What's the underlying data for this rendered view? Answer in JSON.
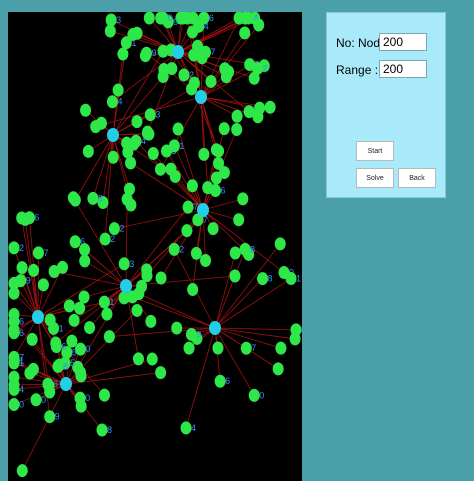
{
  "controls": {
    "nodes_label": "No: Nodes:",
    "nodes_value": "200",
    "range_label": "Range   :",
    "range_value": "200",
    "start_label": "Start",
    "solve_label": "Solve",
    "back_label": "Back"
  },
  "colors": {
    "canvas_bg": "#000000",
    "node": "#2ee84a",
    "hub": "#22cfe6",
    "edge": "#a01010",
    "label": "#3b8cff",
    "panel_bg": "#a9eafa",
    "page_bg": "#4a9fa8"
  },
  "graph": {
    "hubs": 8,
    "nodes": 200,
    "edges_per_node": 1
  }
}
